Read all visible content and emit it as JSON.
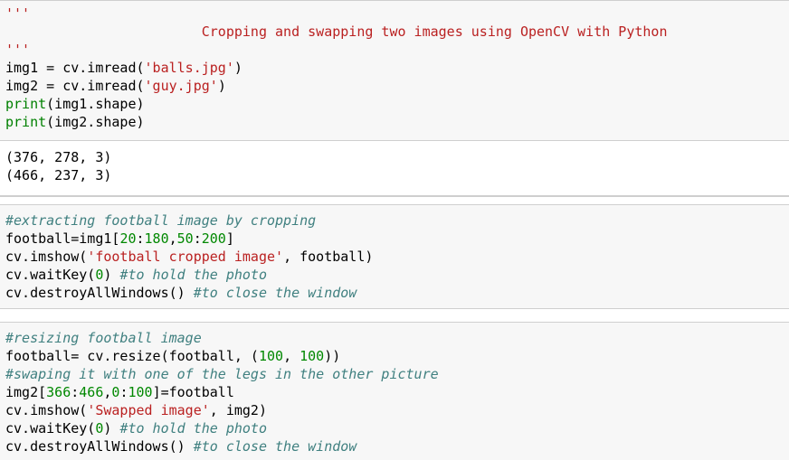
{
  "cell1": {
    "doc_open": "'''",
    "doc_title": "                        Cropping and swapping two images using OpenCV with Python",
    "doc_close": "'''",
    "lines": [
      "img1 = cv.imread('balls.jpg')",
      "img2 = cv.imread('guy.jpg')",
      "print(img1.shape)",
      "print(img2.shape)"
    ]
  },
  "output1": {
    "lines": [
      "(376, 278, 3)",
      "(466, 237, 3)"
    ]
  },
  "cell2": {
    "comment": "#extracting football image by cropping",
    "lines": [
      "football=img1[20:180,50:200]",
      "cv.imshow('football cropped image', football)",
      "cv.waitKey(0) #to hold the photo",
      "cv.destroyAllWindows() #to close the window"
    ]
  },
  "cell3": {
    "comment1": "#resizing football image",
    "line1": "football= cv.resize(football, (100, 100))",
    "comment2": "#swaping it with one of the legs in the other picture",
    "lines": [
      "img2[366:466,0:100]=football",
      "cv.imshow('Swapped image', img2)",
      "cv.waitKey(0) #to hold the photo",
      "cv.destroyAllWindows() #to close the window"
    ]
  },
  "colors": {
    "cell_bg": "#f7f7f7",
    "string": "#ba2121",
    "comment": "#408080",
    "keyword": "#008000"
  }
}
